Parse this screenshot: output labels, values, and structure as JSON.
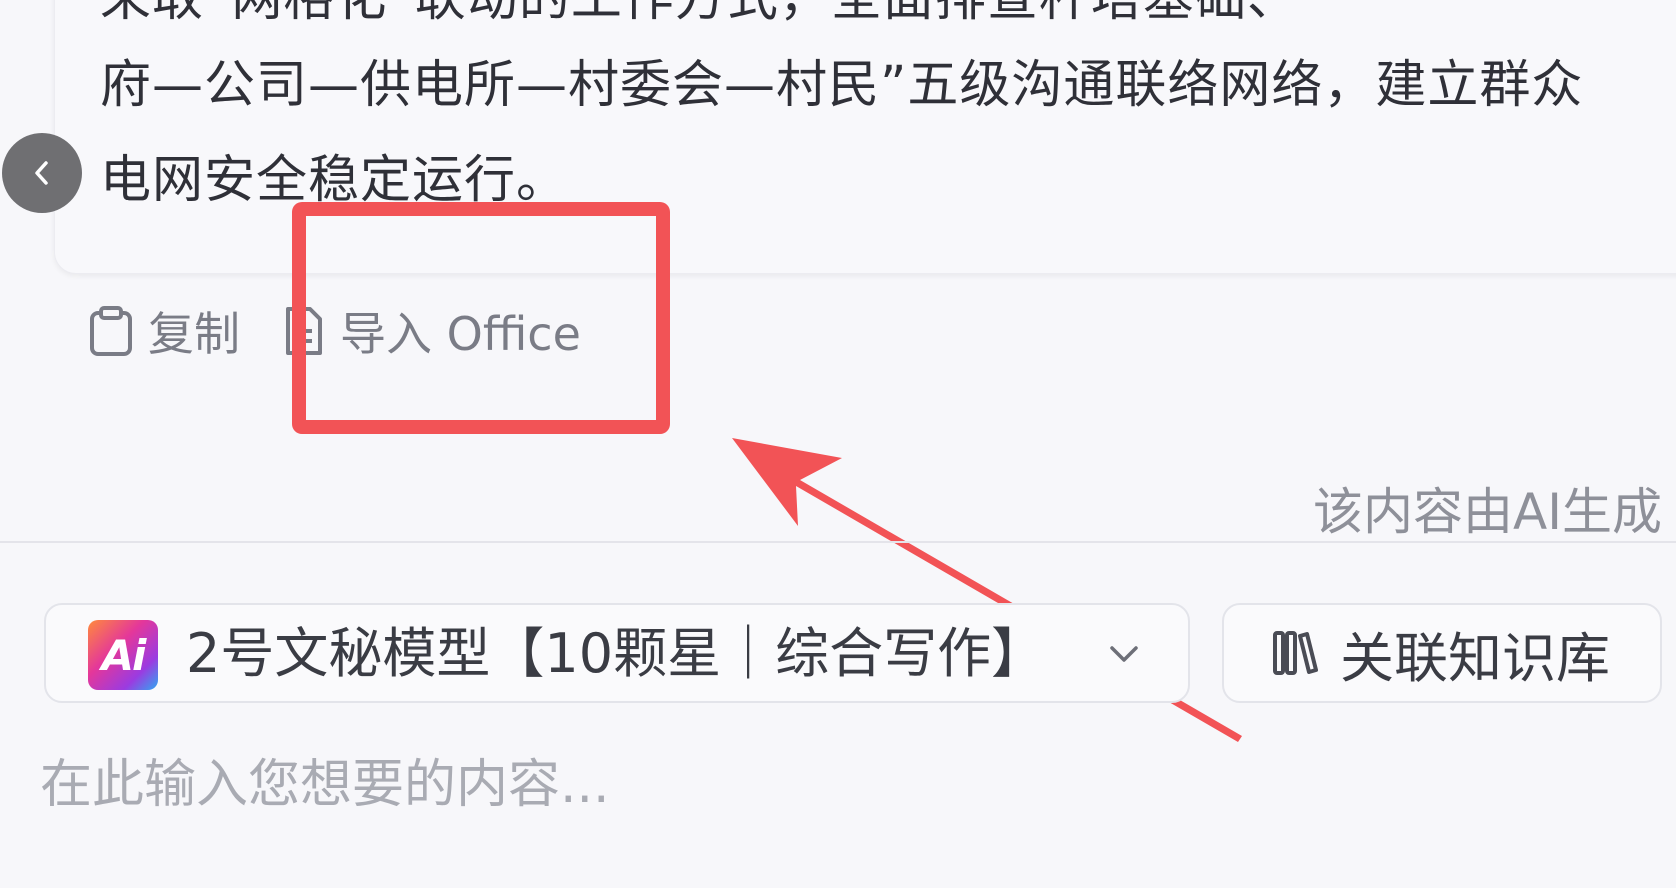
{
  "message": {
    "lines": [
      "采取“网格化”联动的工作方式，全面排查杆塔基础、",
      "府—公司—供电所—村委会—村民”五级沟通联络网络，建立群众",
      "电网安全稳定运行。"
    ]
  },
  "actions": {
    "copy_label": "复制",
    "import_office_label": "导入 Office"
  },
  "disclaimer": "该内容由AI生成",
  "composer": {
    "model_label": "2号文秘模型【10颗星｜综合写作】",
    "model_logo_text": "Ai",
    "knowledge_base_label": "关联知识库",
    "input_placeholder": "在此输入您想要的内容..."
  },
  "icons": {
    "back": "chevron-left-icon",
    "copy": "clipboard-icon",
    "import_office": "document-icon",
    "dropdown": "chevron-down-icon",
    "knowledge_base": "books-icon"
  },
  "colors": {
    "annotation_red": "#f25356",
    "background": "#f7f7fa",
    "text_muted": "#7a7c86"
  }
}
